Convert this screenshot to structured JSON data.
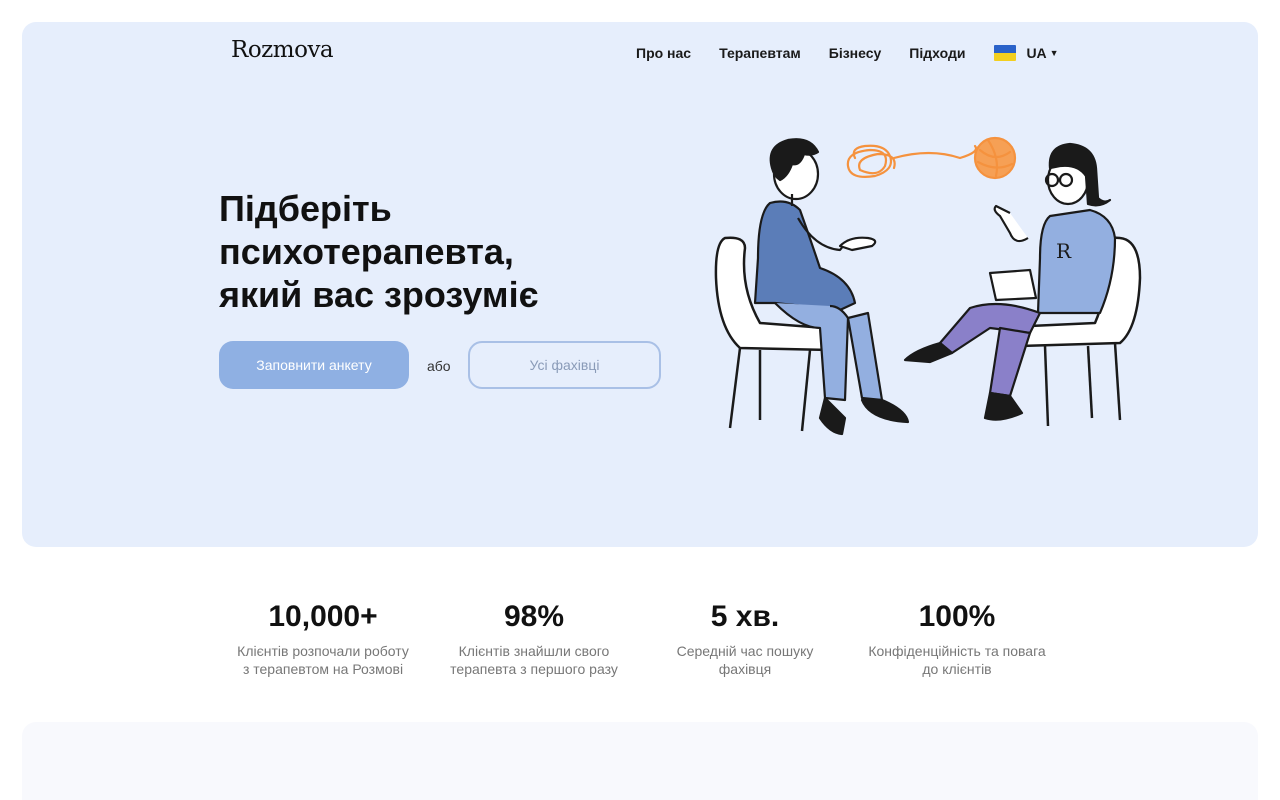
{
  "header": {
    "logo": "Rozmova",
    "nav": [
      "Про нас",
      "Терапевтам",
      "Бізнесу",
      "Підходи"
    ],
    "language": "UA"
  },
  "hero": {
    "headline_lines": [
      "Підберіть",
      "психотерапевта,",
      "який вас зрозуміє"
    ],
    "primary_button": "Заповнити анкету",
    "or_text": "або",
    "secondary_button": "Усі фахівці"
  },
  "stats": [
    {
      "value": "10,000+",
      "desc_lines": [
        "Клієнтів розпочали роботу",
        "з терапевтом на Розмові"
      ]
    },
    {
      "value": "98%",
      "desc_lines": [
        "Клієнтів знайшли свого",
        "терапевта з першого разу"
      ]
    },
    {
      "value": "5 хв.",
      "desc_lines": [
        "Середній час пошуку",
        "фахівця"
      ]
    },
    {
      "value": "100%",
      "desc_lines": [
        "Конфіденційність та повага",
        "до клієнтів"
      ]
    }
  ],
  "colors": {
    "hero_bg": "#e6eefc",
    "primary_button": "#8fb0e3",
    "secondary_border": "#a9c0e6",
    "accent_orange": "#f5923e",
    "figure_blue": "#5b7db8"
  },
  "icons": [
    "ukraine-flag-icon",
    "chevron-down-icon"
  ]
}
